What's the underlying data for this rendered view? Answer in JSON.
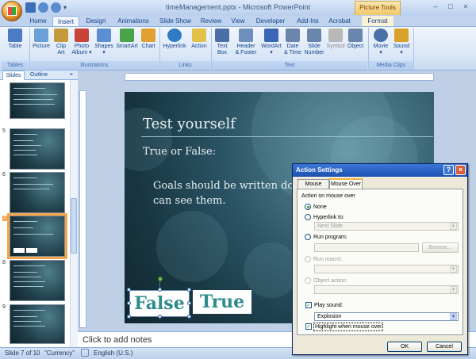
{
  "window": {
    "title": "timeManagement.pptx - Microsoft PowerPoint",
    "contextual_tab_group": "Picture Tools",
    "controls": [
      "–",
      "□",
      "×"
    ]
  },
  "tabs": [
    "Home",
    "Insert",
    "Design",
    "Animations",
    "Slide Show",
    "Review",
    "View",
    "Developer",
    "Add-Ins",
    "Acrobat",
    "Format"
  ],
  "active_tab": "Insert",
  "ribbon": {
    "groups": [
      {
        "label": "Tables"
      },
      {
        "label": "Illustrations"
      },
      {
        "label": "Links"
      },
      {
        "label": "Text"
      },
      {
        "label": "Media Clips"
      }
    ],
    "buttons": [
      {
        "l1": "Table",
        "l2": "",
        "icon": "table-icon",
        "color": "#4a7bc4"
      },
      {
        "l1": "Picture",
        "l2": "",
        "icon": "picture-icon",
        "color": "#6a9fd8"
      },
      {
        "l1": "Clip",
        "l2": "Art",
        "icon": "clip-art-icon",
        "color": "#c59a3d"
      },
      {
        "l1": "Photo",
        "l2": "Album ▾",
        "icon": "photo-album-icon",
        "color": "#c8433a"
      },
      {
        "l1": "Shapes",
        "l2": "▾",
        "icon": "shapes-icon",
        "color": "#5a8fd4"
      },
      {
        "l1": "SmartArt",
        "l2": "",
        "icon": "smartart-icon",
        "color": "#4aa34a"
      },
      {
        "l1": "Chart",
        "l2": "",
        "icon": "chart-icon",
        "color": "#e0a030"
      },
      {
        "l1": "Hyperlink",
        "l2": "",
        "icon": "hyperlink-icon",
        "color": "#2f7bc4"
      },
      {
        "l1": "Action",
        "l2": "",
        "icon": "action-icon",
        "color": "#e3c24a"
      },
      {
        "l1": "Text",
        "l2": "Box",
        "icon": "text-box-icon",
        "color": "#4b6ea9"
      },
      {
        "l1": "Header",
        "l2": "& Footer",
        "icon": "header-footer-icon",
        "color": "#6f8fbc"
      },
      {
        "l1": "WordArt",
        "l2": "▾",
        "icon": "wordart-icon",
        "color": "#3b66b8"
      },
      {
        "l1": "Date",
        "l2": "& Time",
        "icon": "date-time-icon",
        "color": "#6b86ad"
      },
      {
        "l1": "Slide",
        "l2": "Number",
        "icon": "slide-number-icon",
        "color": "#6b86ad"
      },
      {
        "l1": "Symbol",
        "l2": "",
        "icon": "symbol-icon",
        "color": "#8a8a8a"
      },
      {
        "l1": "Object",
        "l2": "",
        "icon": "object-icon",
        "color": "#6b86ad"
      },
      {
        "l1": "Movie",
        "l2": "▾",
        "icon": "movie-icon",
        "color": "#4a70a8"
      },
      {
        "l1": "Sound",
        "l2": "▾",
        "icon": "sound-icon",
        "color": "#d9a12a"
      }
    ]
  },
  "slides_pane": {
    "tabs": [
      "Slides",
      "Outline"
    ],
    "close": "×",
    "thumbnails": [
      {
        "num": ""
      },
      {
        "num": "5"
      },
      {
        "num": "6"
      },
      {
        "num": "7"
      },
      {
        "num": "8"
      },
      {
        "num": "9"
      }
    ]
  },
  "slide": {
    "title": "Test yourself",
    "subtitle": "True or False:",
    "body_line1": "Goals should be written down",
    "body_line2": "can see them.",
    "button_false": "False",
    "button_true": "True"
  },
  "notes": {
    "placeholder": "Click to add notes"
  },
  "status": {
    "slide_info": "Slide 7 of 10",
    "theme": "\"Currency\"",
    "language": "English (U.S.)"
  },
  "dialog": {
    "title": "Action Settings",
    "help": "?",
    "close": "×",
    "tabs": [
      "Mouse Click",
      "Mouse Over"
    ],
    "active_tab": "Mouse Over",
    "group_label": "Action on mouse over",
    "options": {
      "none": "None",
      "hyperlink": "Hyperlink to:",
      "run_program": "Run program:",
      "run_macro": "Run macro:",
      "object_action": "Object action:"
    },
    "hyperlink_value": "Next Slide",
    "browse": "Browse...",
    "play_sound": "Play sound:",
    "sound_value": "Explosion",
    "highlight": "Highlight when mouse over",
    "ok": "OK",
    "cancel": "Cancel"
  },
  "colors": {
    "accent": "#15428b",
    "selection": "#f7a54a",
    "slide_text": "#eaf0f3",
    "button_text": "#2e8b8b"
  }
}
